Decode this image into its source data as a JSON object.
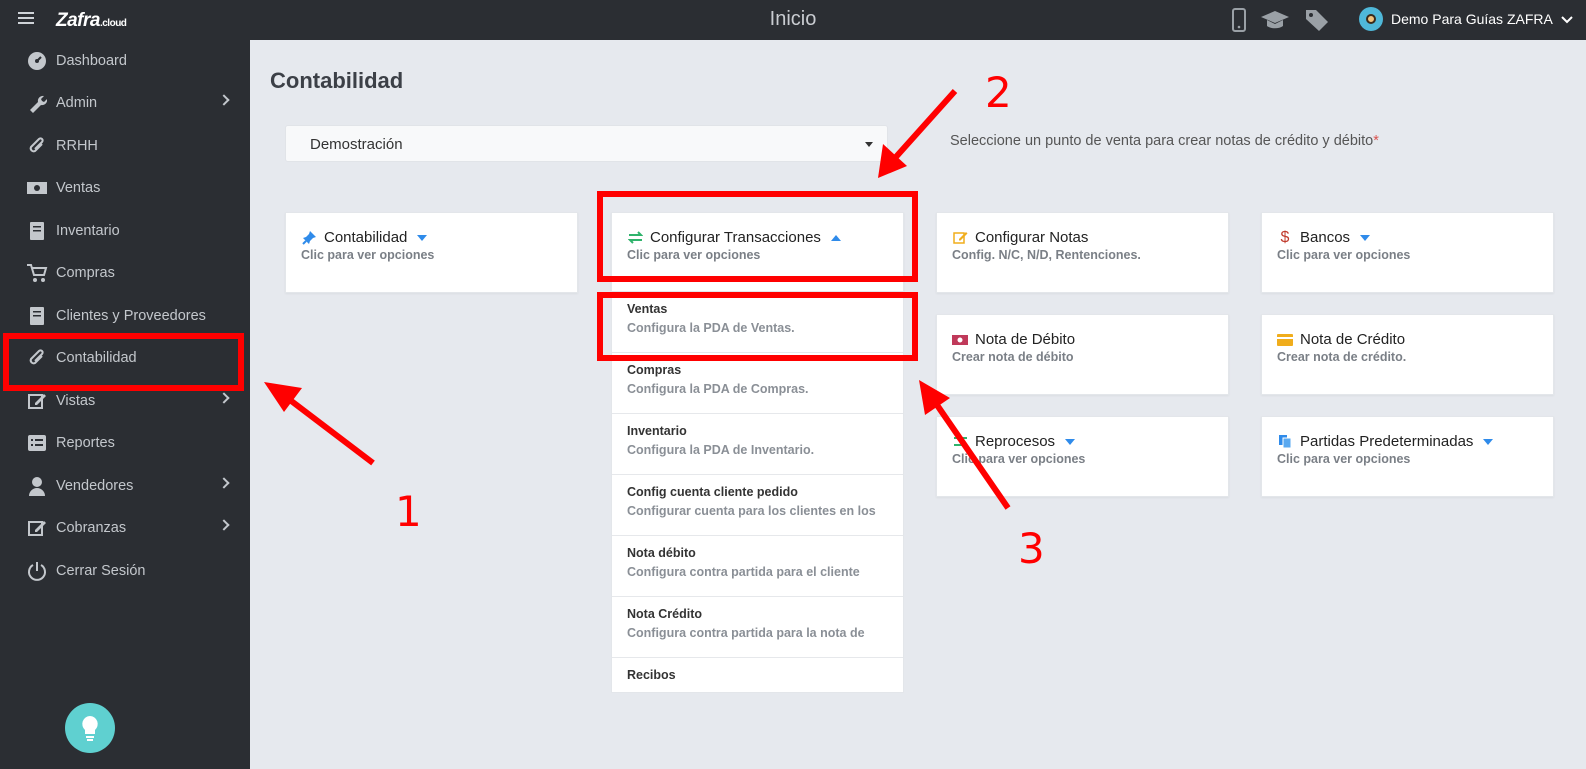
{
  "header": {
    "logo_text": "Zafra",
    "logo_suffix": ".cloud",
    "title": "Inicio",
    "user_name": "Demo Para Guías ZAFRA",
    "icons": [
      "mobile-icon",
      "graduation-cap-icon",
      "tags-icon"
    ]
  },
  "sidebar": {
    "items": [
      {
        "label": "Dashboard",
        "icon": "dashboard-icon"
      },
      {
        "label": "Admin",
        "icon": "wrench-icon"
      },
      {
        "label": "RRHH",
        "icon": "paperclip-icon"
      },
      {
        "label": "Ventas",
        "icon": "money-icon"
      },
      {
        "label": "Inventario",
        "icon": "book-icon"
      },
      {
        "label": "Compras",
        "icon": "cart-icon"
      },
      {
        "label": "Clientes y Proveedores",
        "icon": "book-icon"
      },
      {
        "label": "Contabilidad",
        "icon": "paperclip-icon"
      },
      {
        "label": "Vistas",
        "icon": "edit-icon"
      },
      {
        "label": "Reportes",
        "icon": "list-icon"
      },
      {
        "label": "Vendedores",
        "icon": "user-icon"
      },
      {
        "label": "Cobranzas",
        "icon": "edit-icon"
      },
      {
        "label": "Cerrar Sesión",
        "icon": "power-icon"
      }
    ]
  },
  "main": {
    "title": "Contabilidad",
    "select_value": "Demostración",
    "hint": "Seleccione un punto de venta para crear notas de crédito y débito",
    "hint_required": "*"
  },
  "cards": {
    "contabilidad": {
      "title": "Contabilidad",
      "sub": "Clic para ver opciones"
    },
    "config_transacciones": {
      "title": "Configurar Transacciones",
      "sub": "Clic para ver opciones"
    },
    "config_notas": {
      "title": "Configurar Notas",
      "sub": "Config. N/C, N/D, Rentenciones."
    },
    "bancos": {
      "title": "Bancos",
      "sub": "Clic para ver opciones"
    },
    "nota_debito": {
      "title": "Nota de Débito",
      "sub": "Crear nota de débito"
    },
    "nota_credito": {
      "title": "Nota de Crédito",
      "sub": "Crear nota de crédito."
    },
    "reprocesos": {
      "title": "Reprocesos",
      "sub": "Clic para ver opciones"
    },
    "partidas": {
      "title": "Partidas Predeterminadas",
      "sub": "Clic para ver opciones"
    }
  },
  "dropdown": {
    "items": [
      {
        "title": "Ventas",
        "desc": "Configura la PDA de Ventas."
      },
      {
        "title": "Compras",
        "desc": "Configura la PDA de Compras."
      },
      {
        "title": "Inventario",
        "desc": "Configura la PDA de Inventario."
      },
      {
        "title": "Config cuenta cliente pedido",
        "desc": "Configurar cuenta para los clientes en los"
      },
      {
        "title": "Nota débito",
        "desc": "Configura contra partida para el cliente"
      },
      {
        "title": "Nota Crédito",
        "desc": "Configura contra partida para la nota de"
      },
      {
        "title": "Recibos",
        "desc": ""
      }
    ]
  },
  "annotations": {
    "n1": "1",
    "n2": "2",
    "n3": "3"
  },
  "colors": {
    "annotation": "#ff0000",
    "sidebar": "#2b2e33",
    "accent": "#2f8bea"
  }
}
